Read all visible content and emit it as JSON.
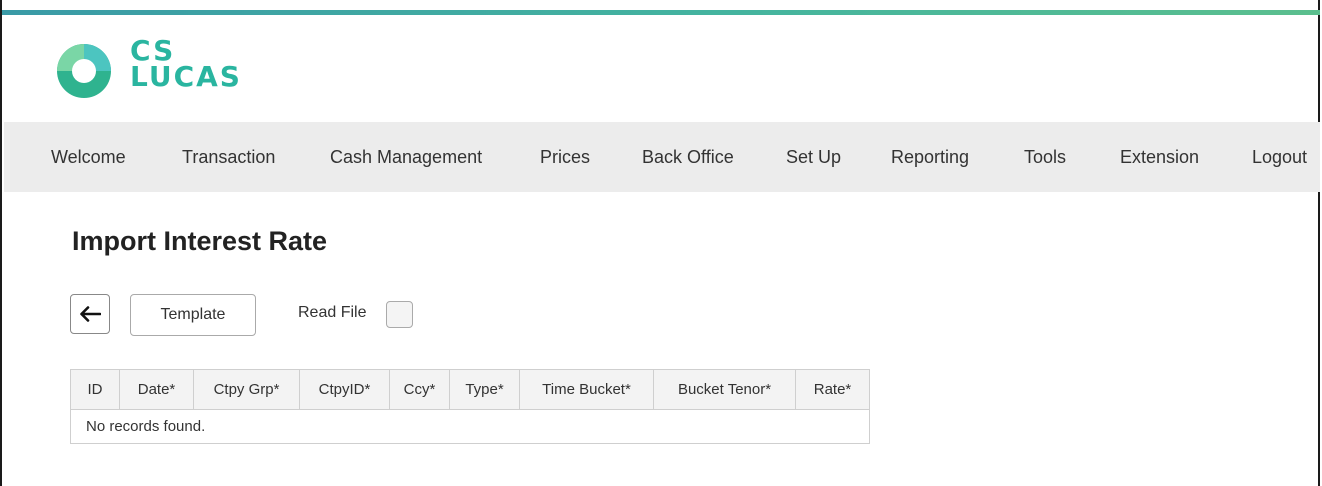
{
  "brand": {
    "line1": "CS",
    "line2": "LUCAS",
    "color": "#2ab5a0"
  },
  "nav": {
    "items": [
      {
        "label": "Welcome"
      },
      {
        "label": "Transaction"
      },
      {
        "label": "Cash Management"
      },
      {
        "label": "Prices"
      },
      {
        "label": "Back Office"
      },
      {
        "label": "Set Up"
      },
      {
        "label": "Reporting"
      },
      {
        "label": "Tools"
      },
      {
        "label": "Extension"
      },
      {
        "label": "Logout"
      }
    ]
  },
  "page": {
    "title": "Import Interest Rate"
  },
  "toolbar": {
    "back_icon": "arrow-left-icon",
    "template_label": "Template",
    "read_file_label": "Read File",
    "read_file_checked": false
  },
  "table": {
    "columns": [
      "ID",
      "Date*",
      "Ctpy Grp*",
      "CtpyID*",
      "Ccy*",
      "Type*",
      "Time Bucket*",
      "Bucket Tenor*",
      "Rate*"
    ],
    "empty_message": "No records found."
  },
  "colors": {
    "accent": "#2ab5a0",
    "nav_bg": "#ececec"
  }
}
